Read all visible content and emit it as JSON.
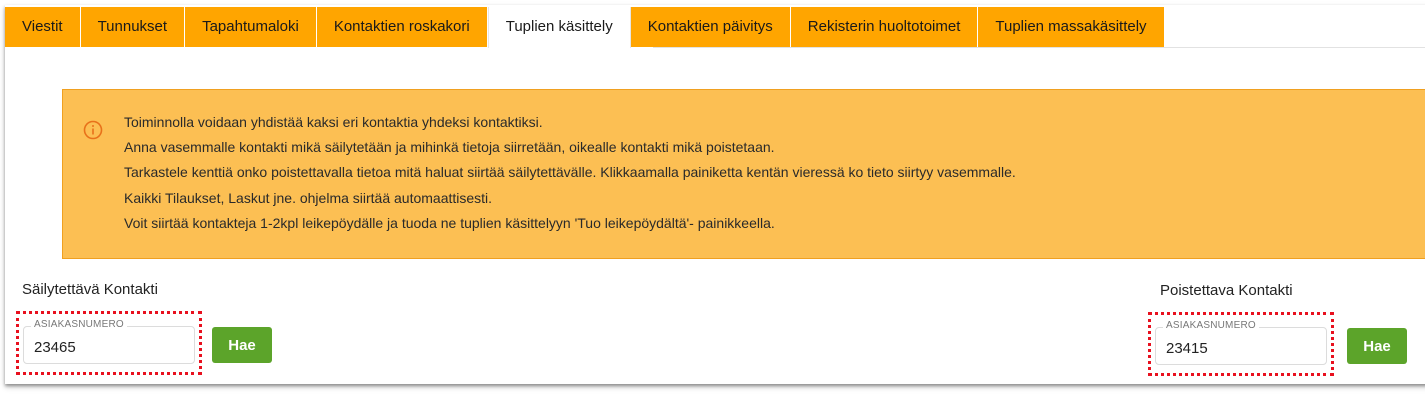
{
  "tabs": [
    {
      "label": "Viestit",
      "active": false
    },
    {
      "label": "Tunnukset",
      "active": false
    },
    {
      "label": "Tapahtumaloki",
      "active": false
    },
    {
      "label": "Kontaktien roskakori",
      "active": false
    },
    {
      "label": "Tuplien käsittely",
      "active": true
    },
    {
      "label": "Kontaktien päivitys",
      "active": false
    },
    {
      "label": "Rekisterin huoltotoimet",
      "active": false
    },
    {
      "label": "Tuplien massakäsittely",
      "active": false
    }
  ],
  "info": {
    "lines": [
      "Toiminnolla voidaan yhdistää kaksi eri kontaktia yhdeksi kontaktiksi.",
      "Anna vasemmalle kontakti mikä säilytetään ja mihinkä tietoja siirretään, oikealle kontakti mikä poistetaan.",
      "Tarkastele kenttiä onko poistettavalla tietoa mitä haluat siirtää säilytettävälle. Klikkaamalla painiketta kentän vieressä ko tieto siirtyy vasemmalle.",
      "Kaikki Tilaukset, Laskut jne. ohjelma siirtää automaattisesti.",
      "Voit siirtää kontakteja 1-2kpl leikepöydälle ja tuoda ne tuplien käsittelyyn 'Tuo leikepöydältä'- painikkeella."
    ]
  },
  "keep": {
    "title": "Säilytettävä Kontakti",
    "field_label": "ASIAKASNUMERO",
    "value": "23465",
    "button": "Hae"
  },
  "remove": {
    "title": "Poistettava Kontakti",
    "field_label": "ASIAKASNUMERO",
    "value": "23415",
    "button": "Hae"
  },
  "colors": {
    "tab_bg": "#ffa500",
    "info_bg": "#fcbf53",
    "button_bg": "#5ca42a",
    "highlight": "#e8101e"
  }
}
